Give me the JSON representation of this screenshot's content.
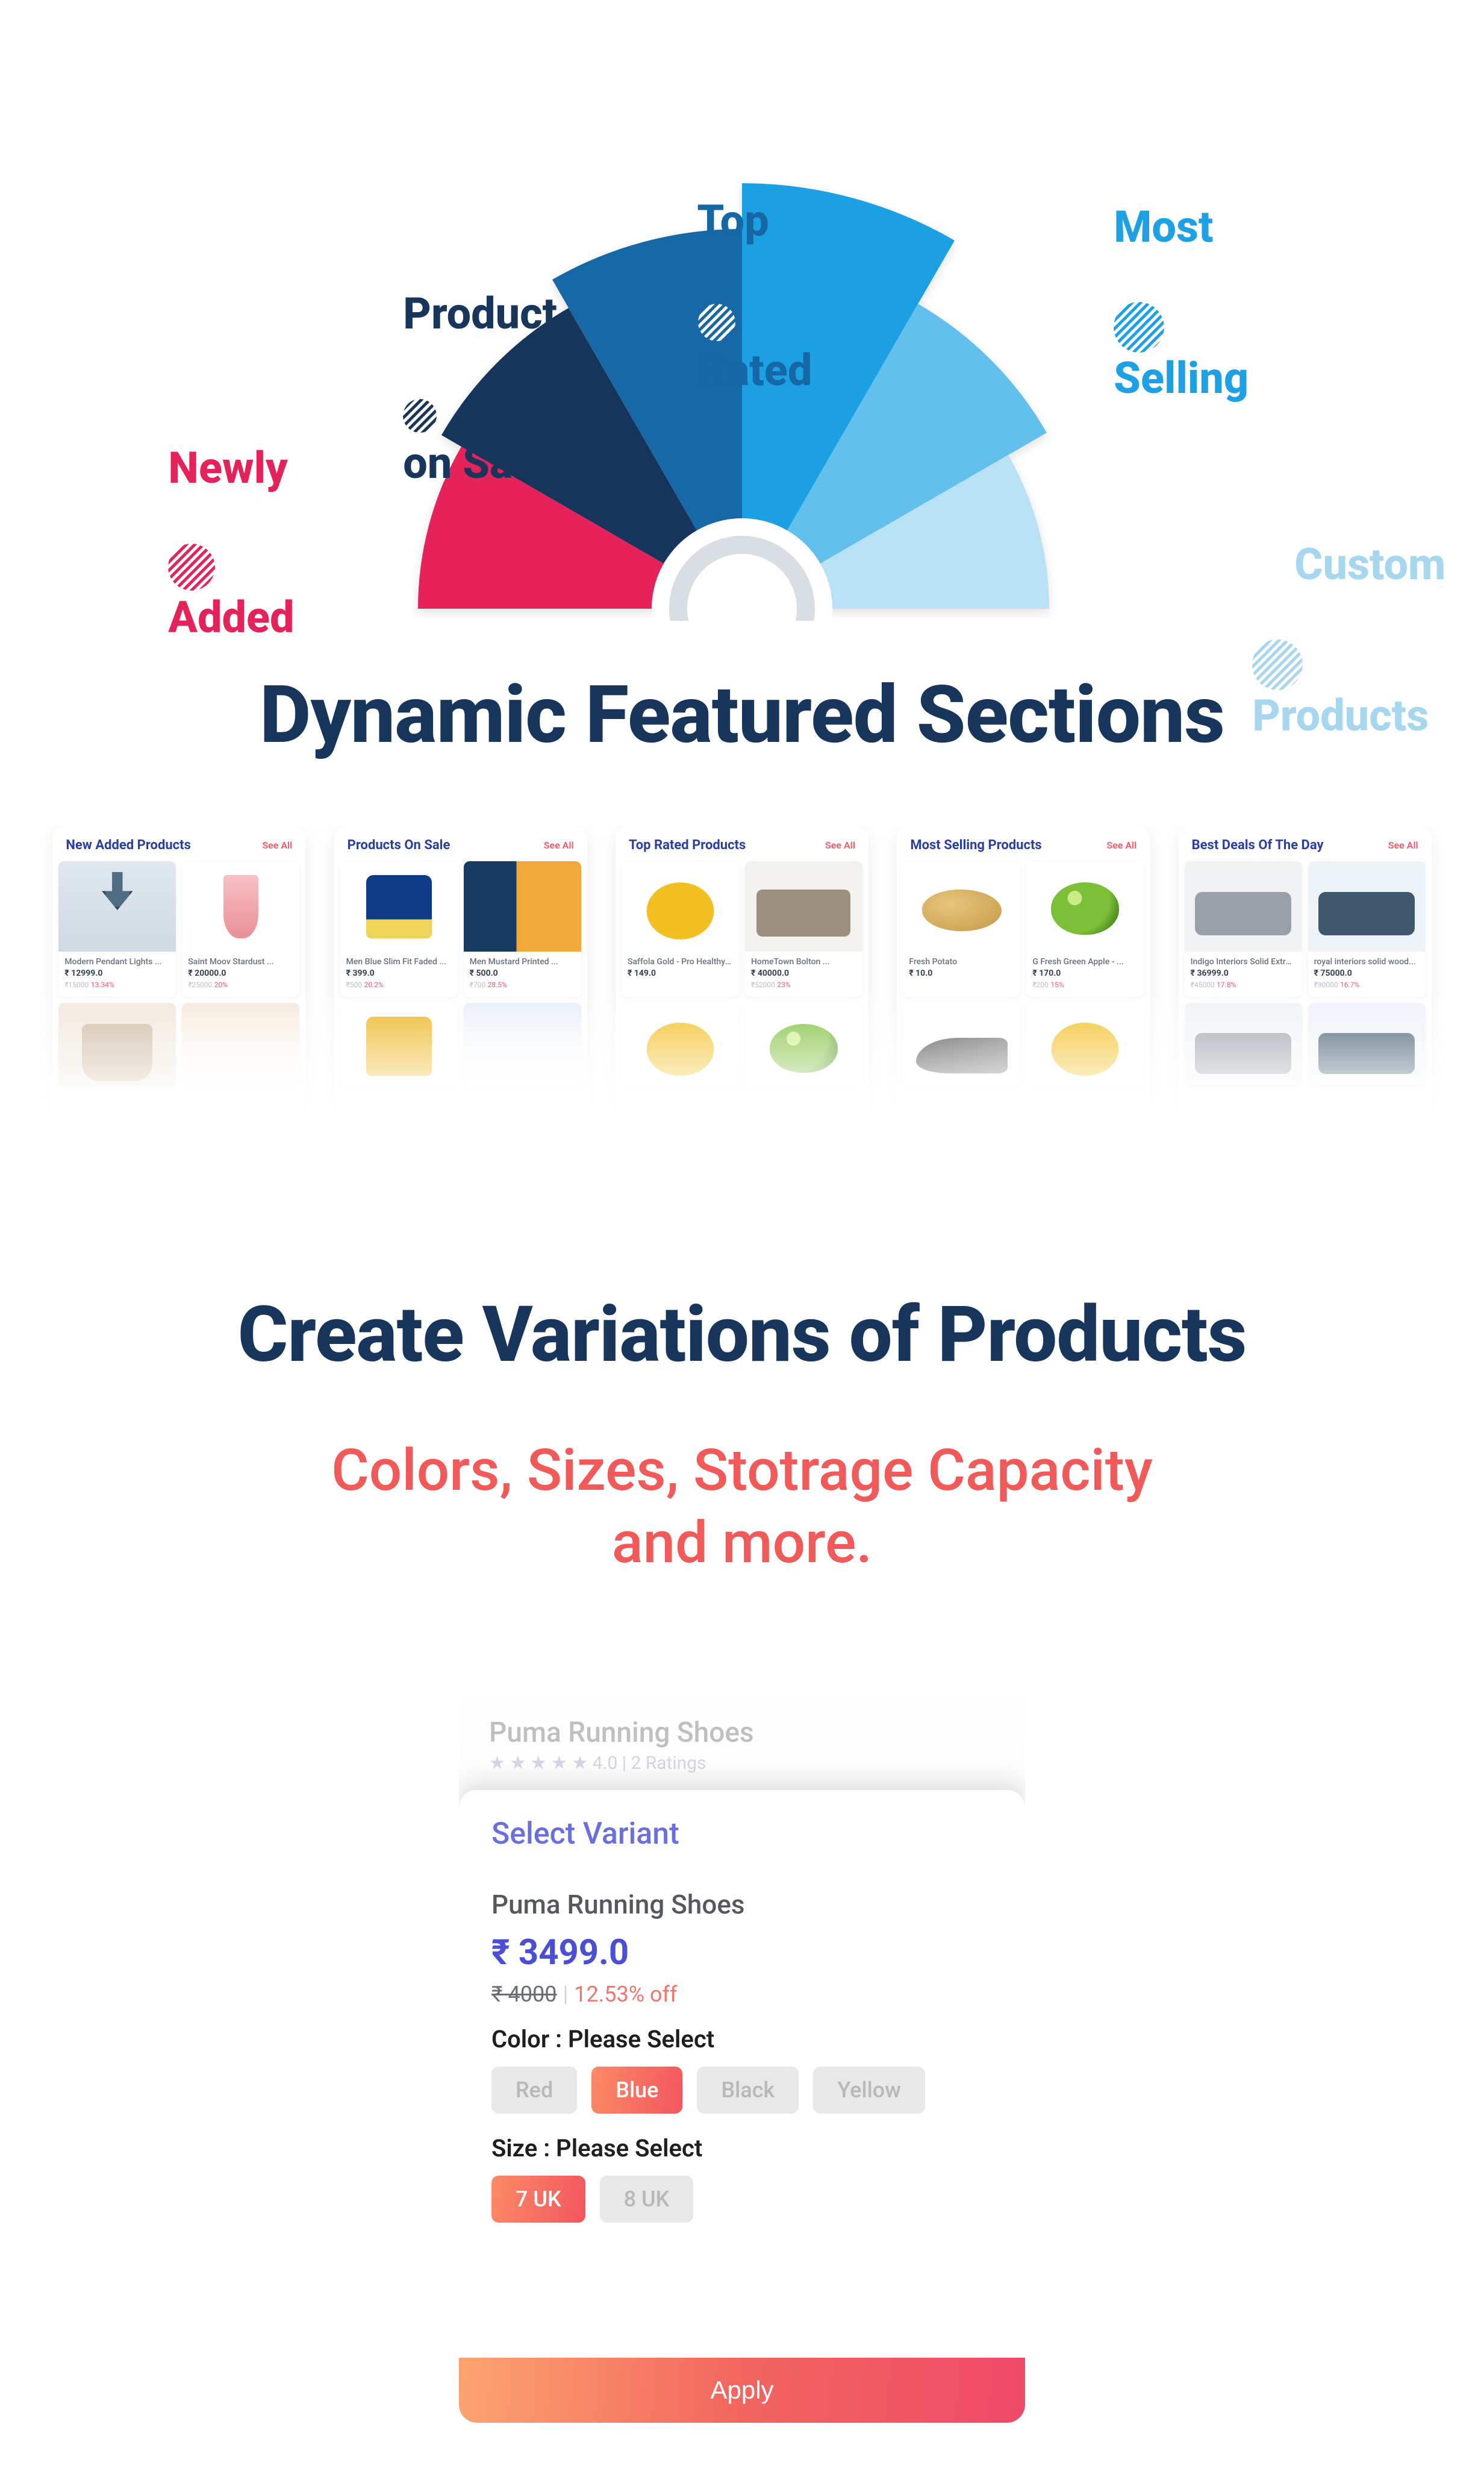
{
  "fan": {
    "labels": [
      {
        "line1": "Newly",
        "line2": "Added",
        "color": "#e5225a"
      },
      {
        "line1": "Product",
        "line2": "on Sale",
        "color": "#18355c"
      },
      {
        "line1": "Top",
        "line2": "Rated",
        "color": "#1667a6"
      },
      {
        "line1": "Most",
        "line2": "Selling",
        "color": "#1ea0e4"
      },
      {
        "line1": "Custom",
        "line2": "Products",
        "color": "#a7d6ef"
      }
    ],
    "slice_colors": [
      "#e5225a",
      "#18355c",
      "#1667a6",
      "#1ea0e4",
      "#63c0ec",
      "#b8e1f6"
    ]
  },
  "title1": "Dynamic Featured Sections",
  "carousel": {
    "see_all": "See All",
    "sections": [
      {
        "title": "New Added Products",
        "items": [
          {
            "name": "Modern Pendant Lights ...",
            "price": "₹ 12999.0",
            "old": "₹15000",
            "off": "13.34%",
            "sku": "lamp"
          },
          {
            "name": "Saint Moov Stardust ...",
            "price": "₹ 20000.0",
            "old": "₹25000",
            "off": "20%",
            "sku": "glass"
          },
          {
            "name": "",
            "price": "",
            "sku": "chair"
          },
          {
            "name": "",
            "price": "",
            "sku": "mix1"
          }
        ]
      },
      {
        "title": "Products On Sale",
        "items": [
          {
            "name": "Men Blue Slim Fit Faded ...",
            "price": "₹ 399.0",
            "old": "₹500",
            "off": "20.2%",
            "sku": "tee-bl"
          },
          {
            "name": "Men Mustard Printed ...",
            "price": "₹ 500.0",
            "old": "₹700",
            "off": "28.5%",
            "sku": "tee-or"
          },
          {
            "name": "",
            "price": "",
            "sku": "tee-yl"
          },
          {
            "name": "",
            "price": "",
            "sku": "mix2"
          }
        ]
      },
      {
        "title": "Top Rated Products",
        "items": [
          {
            "name": "Saffola Gold - Pro Healthy ...",
            "price": "₹ 149.0",
            "old": "",
            "off": "",
            "sku": "oil"
          },
          {
            "name": "HomeTown Bolton ...",
            "price": "₹ 40000.0",
            "old": "₹52000",
            "off": "23%",
            "sku": "sofa"
          },
          {
            "name": "",
            "price": "",
            "sku": "oil"
          },
          {
            "name": "",
            "price": "",
            "sku": "apple"
          }
        ]
      },
      {
        "title": "Most Selling Products",
        "items": [
          {
            "name": "Fresh Potato",
            "price": "₹ 10.0",
            "old": "",
            "off": "",
            "sku": "potato"
          },
          {
            "name": "G Fresh Green Apple - ...",
            "price": "₹ 170.0",
            "old": "₹200",
            "off": "15%",
            "sku": "apple"
          },
          {
            "name": "",
            "price": "",
            "sku": "shoe"
          },
          {
            "name": "",
            "price": "",
            "sku": "oil"
          }
        ]
      },
      {
        "title": "Best Deals Of The Day",
        "items": [
          {
            "name": "Indigo Interiors Solid Extra...",
            "price": "₹ 36999.0",
            "old": "₹45000",
            "off": "17.8%",
            "sku": "sofa2"
          },
          {
            "name": "royal interiors solid wood...",
            "price": "₹ 75000.0",
            "old": "₹90000",
            "off": "16.7%",
            "sku": "sofa3"
          },
          {
            "name": "",
            "price": "",
            "sku": "sofa2"
          },
          {
            "name": "",
            "price": "",
            "sku": "sofa3"
          }
        ]
      }
    ]
  },
  "title2": "Create Variations of Products",
  "subtitle2": "Colors, Sizes, Stotrage Capacity\nand more.",
  "variant": {
    "bg_name": "Puma Running Shoes",
    "bg_rating": "★ ★ ★ ★ ★ 4.0 | 2 Ratings",
    "sheet_title": "Select Variant",
    "name": "Puma Running Shoes",
    "price": "₹ 3499.0",
    "old": "₹ 4000",
    "off": "12.53% off",
    "attr1_label": "Color : Please Select",
    "colors": [
      {
        "label": "Red",
        "active": false
      },
      {
        "label": "Blue",
        "active": true
      },
      {
        "label": "Black",
        "active": false
      },
      {
        "label": "Yellow",
        "active": false
      }
    ],
    "attr2_label": "Size : Please Select",
    "sizes": [
      {
        "label": "7 UK",
        "active": true
      },
      {
        "label": "8 UK",
        "active": false
      }
    ],
    "apply": "Apply"
  }
}
